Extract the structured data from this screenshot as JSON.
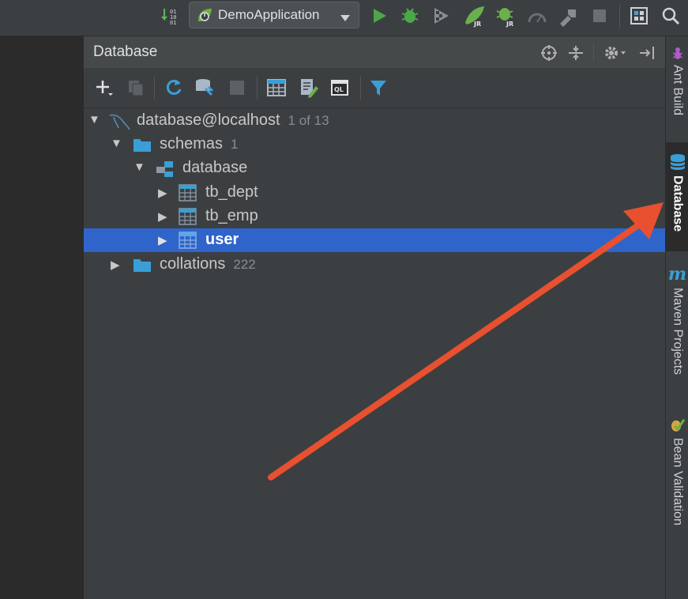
{
  "toolbar": {
    "run_config": "DemoApplication",
    "buttons": [
      "sort-icon",
      "run-icon",
      "debug-icon",
      "coverage-icon",
      "jrebel-run-icon",
      "jrebel-debug-icon",
      "profile-icon",
      "build-icon",
      "stop-icon",
      "project-structure-icon",
      "search-icon"
    ]
  },
  "panel": {
    "title": "Database",
    "tools": [
      "add-icon",
      "duplicate-icon",
      "refresh-icon",
      "db-settings-icon",
      "stop-icon",
      "table-icon",
      "edit-icon",
      "console-icon",
      "filter-icon"
    ]
  },
  "tree": [
    {
      "label": "database@localhost",
      "count": "1 of 13"
    },
    {
      "label": "schemas",
      "count": "1"
    },
    {
      "label": "database",
      "count": ""
    },
    {
      "label": "tb_dept",
      "count": ""
    },
    {
      "label": "tb_emp",
      "count": ""
    },
    {
      "label": "user",
      "count": ""
    },
    {
      "label": "collations",
      "count": "222"
    }
  ],
  "right_tabs": [
    {
      "label": "Ant Build",
      "icon": "ant-icon"
    },
    {
      "label": "Database",
      "icon": "database-icon"
    },
    {
      "label": "Maven Projects",
      "icon": "maven-icon"
    },
    {
      "label": "Bean Validation",
      "icon": "bean-validation-icon"
    }
  ],
  "colors": {
    "accent_arrow": "#e8502f",
    "selection": "#2f65ca",
    "folder": "#3a9fd6"
  }
}
